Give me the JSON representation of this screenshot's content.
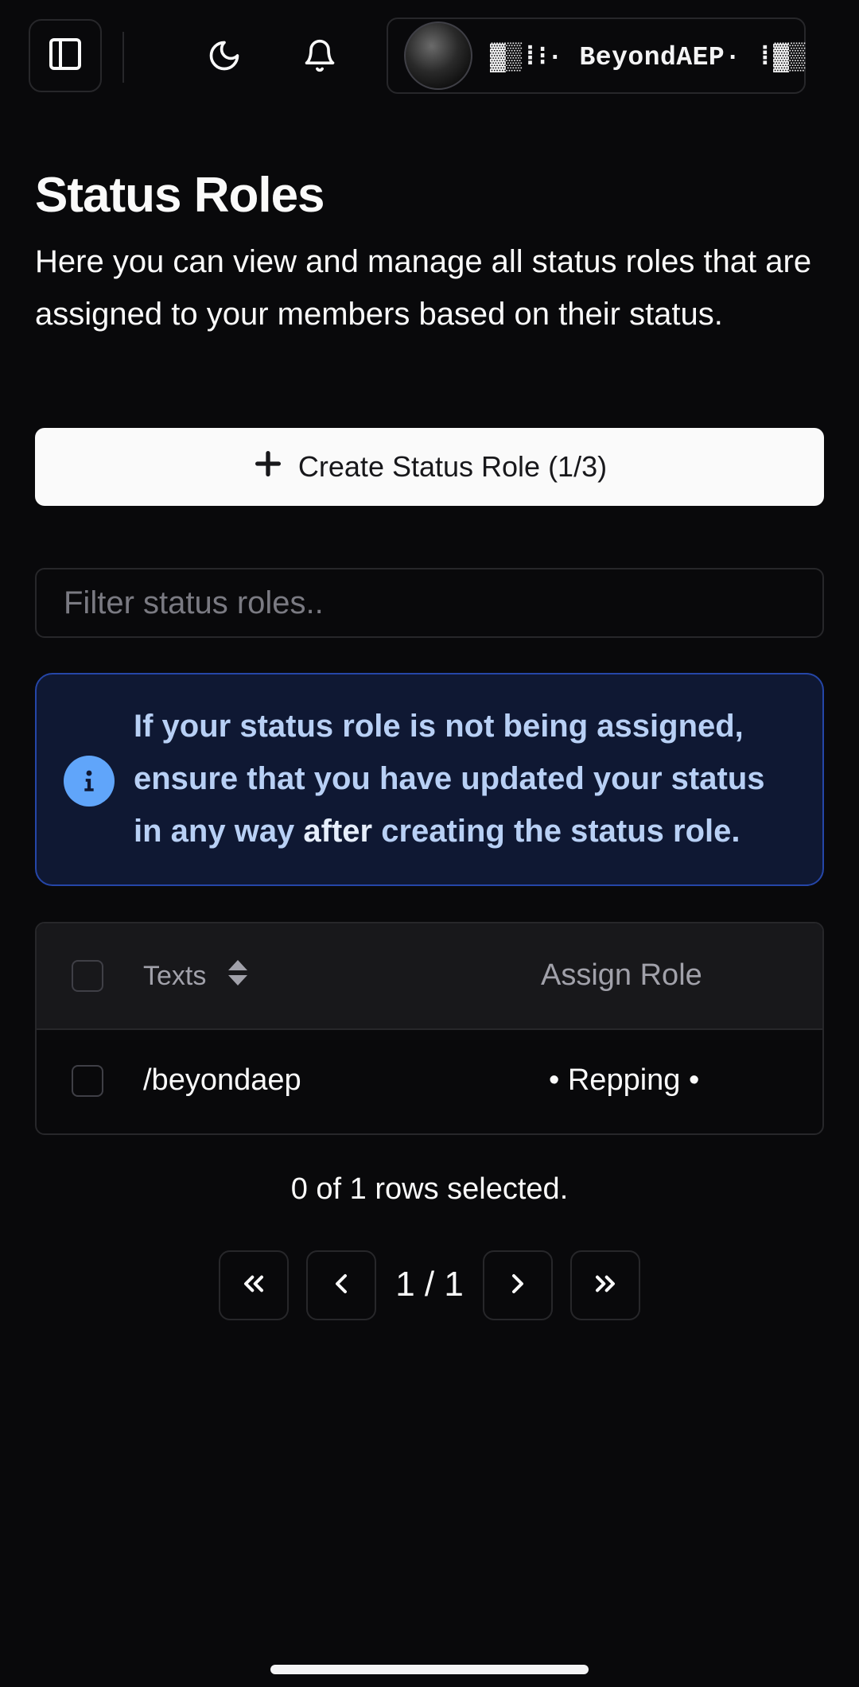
{
  "header": {
    "user": {
      "name": "▓▒⁞⁝· BeyondAEP· ⁞▓▒"
    }
  },
  "page": {
    "title": "Status Roles",
    "description": "Here you can view and manage all status roles that are assigned to your members based on their status."
  },
  "create_button": {
    "label": "Create Status Role (1/3)"
  },
  "filter": {
    "placeholder": "Filter status roles.."
  },
  "alert": {
    "text_before": "If your status role is not being assigned, ensure that you have updated your status in any way ",
    "text_emphasis": "after",
    "text_after": " creating the status role.",
    "color": "#60a5fa"
  },
  "table": {
    "columns": {
      "texts": "Texts",
      "assign_role": "Assign Role"
    },
    "rows": [
      {
        "text": "/beyondaep",
        "role": "• Repping •"
      }
    ]
  },
  "selection": {
    "summary": "0 of 1 rows selected."
  },
  "pagination": {
    "label": "1 / 1"
  },
  "colors": {
    "background": "#09090b",
    "border": "#27272a",
    "alert_bg": "#0f1833",
    "alert_border": "#2546a8",
    "button_bg": "#fafafa"
  }
}
